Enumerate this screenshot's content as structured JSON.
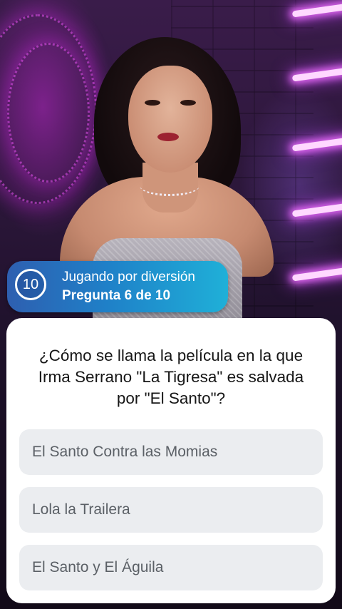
{
  "header": {
    "timer_value": "10",
    "mode_label": "Jugando por diversión",
    "progress_label": "Pregunta 6 de 10"
  },
  "question": {
    "text": "¿Cómo se llama la película en la que Irma Serrano \"La Tigresa\" es salvada por \"El Santo\"?"
  },
  "answers": [
    {
      "label": "El Santo Contra las Momias"
    },
    {
      "label": "Lola la Trailera"
    },
    {
      "label": "El Santo y El Águila"
    }
  ],
  "colors": {
    "pill_gradient_start": "#2e5fb0",
    "pill_gradient_end": "#1fb0d8",
    "card_background": "#ffffff",
    "answer_background": "#ebedf0",
    "answer_text": "#5b6066"
  }
}
